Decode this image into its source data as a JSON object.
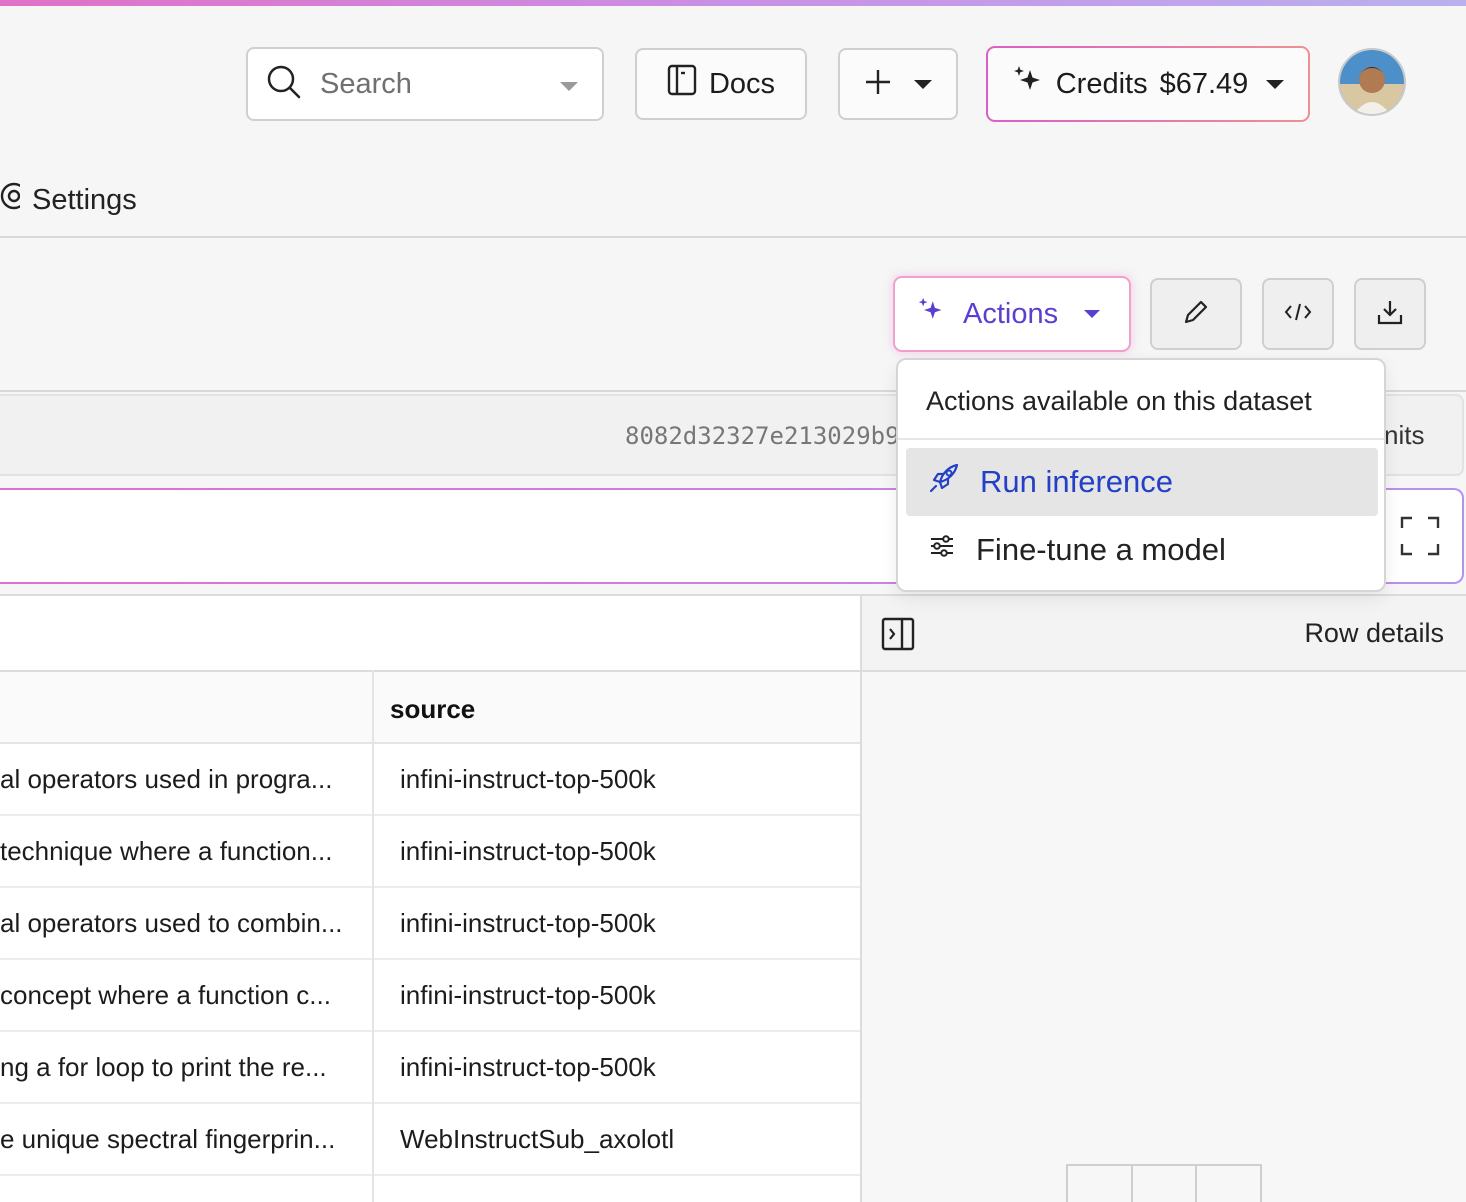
{
  "header": {
    "search_placeholder": "Search",
    "docs_label": "Docs",
    "credits_label": "Credits",
    "credits_value": "$67.49"
  },
  "nav": {
    "settings_label": "Settings"
  },
  "toolbar": {
    "actions_label": "Actions"
  },
  "commit": {
    "hash": "8082d32327e213029b9",
    "suffix": "nits"
  },
  "dropdown": {
    "heading": "Actions available on this dataset",
    "items": [
      {
        "label": "Run inference",
        "icon": "rocket-icon",
        "active": true
      },
      {
        "label": "Fine-tune a model",
        "icon": "sliders-icon",
        "active": false
      }
    ]
  },
  "table": {
    "columns": [
      "source"
    ],
    "rows": [
      {
        "text": "al operators used in progra...",
        "source": "infini-instruct-top-500k"
      },
      {
        "text": " technique where a function...",
        "source": "infini-instruct-top-500k"
      },
      {
        "text": "al operators used to combin...",
        "source": "infini-instruct-top-500k"
      },
      {
        "text": " concept where a function c...",
        "source": "infini-instruct-top-500k"
      },
      {
        "text": "ng a for loop to print the re...",
        "source": "infini-instruct-top-500k"
      },
      {
        "text": "e unique spectral fingerprin...",
        "source": "WebInstructSub_axolotl"
      }
    ]
  },
  "details": {
    "title": "Row details"
  },
  "colors": {
    "accent_purple": "#5b3fd1",
    "active_blue": "#2340c6",
    "gradient_pink": "#e071c6"
  }
}
